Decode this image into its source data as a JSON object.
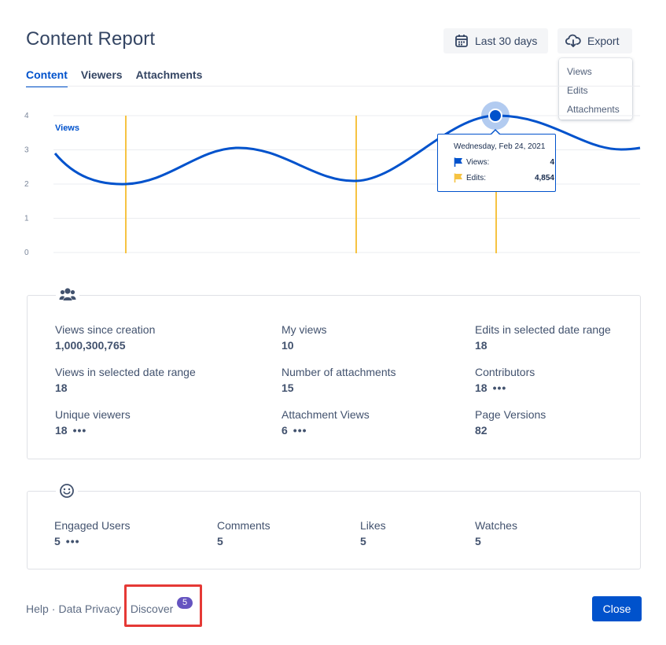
{
  "header": {
    "title": "Content Report",
    "date_range_label": "Last 30 days",
    "export_label": "Export"
  },
  "export_menu": {
    "items": [
      "Views",
      "Edits",
      "Attachments"
    ]
  },
  "tabs": [
    {
      "label": "Content",
      "active": true
    },
    {
      "label": "Viewers",
      "active": false
    },
    {
      "label": "Attachments",
      "active": false
    }
  ],
  "chart_data": {
    "type": "line",
    "series_label": "Views",
    "y_ticks": [
      "0",
      "1",
      "2",
      "3",
      "4"
    ],
    "ylim": [
      0,
      4
    ],
    "grid": true,
    "colors": {
      "views": "#0052cc",
      "edits": "#f6c342"
    },
    "tooltip": {
      "date": "Wednesday, Feb 24, 2021",
      "views_label": "Views:",
      "views_value": "4",
      "edits_label": "Edits:",
      "edits_value": "4,854"
    }
  },
  "stats": {
    "views_since_creation": {
      "label": "Views since creation",
      "value": "1,000,300,765"
    },
    "my_views": {
      "label": "My views",
      "value": "10"
    },
    "edits_in_range": {
      "label": "Edits in selected date range",
      "value": "18"
    },
    "views_in_range": {
      "label": "Views in selected date range",
      "value": "18"
    },
    "num_attachments": {
      "label": "Number of attachments",
      "value": "15"
    },
    "contributors": {
      "label": "Contributors",
      "value": "18"
    },
    "unique_viewers": {
      "label": "Unique viewers",
      "value": "18"
    },
    "attachment_views": {
      "label": "Attachment Views",
      "value": "6"
    },
    "page_versions": {
      "label": "Page Versions",
      "value": "82"
    }
  },
  "engagement": {
    "engaged_users": {
      "label": "Engaged Users",
      "value": "5"
    },
    "comments": {
      "label": "Comments",
      "value": "5"
    },
    "likes": {
      "label": "Likes",
      "value": "5"
    },
    "watches": {
      "label": "Watches",
      "value": "5"
    }
  },
  "footer": {
    "help": "Help",
    "sep": "·",
    "data_privacy": "Data Privacy",
    "discover": "Discover",
    "discover_badge": "5",
    "close": "Close"
  },
  "more_symbol": "•••"
}
